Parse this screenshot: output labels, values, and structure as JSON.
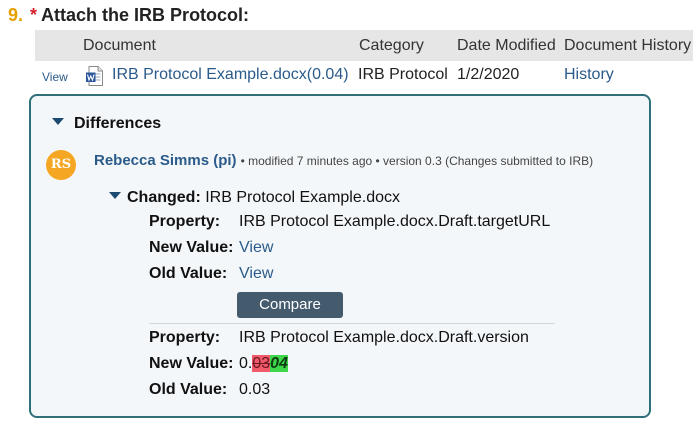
{
  "question": {
    "number": "9.",
    "required_mark": "*",
    "title": "Attach the IRB Protocol:"
  },
  "documents": {
    "columns": {
      "document": "Document",
      "category": "Category",
      "date_modified": "Date Modified",
      "history": "Document History"
    },
    "rows": [
      {
        "view_label": "View",
        "icon": "word-document-icon",
        "name": "IRB Protocol Example.docx(0.04)",
        "category": "IRB Protocol",
        "date_modified": "1/2/2020",
        "history_label": "History"
      }
    ]
  },
  "differences": {
    "title": "Differences",
    "avatar_initials": "RS",
    "avatar_color": "#f5a623",
    "author": "Rebecca Simms (pi)",
    "meta": "• modified 7 minutes ago • version 0.3 (Changes submitted to IRB)",
    "changed_label": "Changed:",
    "changed_item": "IRB Protocol Example.docx",
    "changes": [
      {
        "property_label": "Property:",
        "property": "IRB Protocol Example.docx.Draft.targetURL",
        "new_label": "New Value:",
        "new_value": "View",
        "old_label": "Old Value:",
        "old_value": "View",
        "compare_label": "Compare"
      },
      {
        "property_label": "Property:",
        "property": "IRB Protocol Example.docx.Draft.version",
        "new_label": "New Value:",
        "new_prefix": "0.",
        "new_deleted": "03",
        "new_inserted": "04",
        "old_label": "Old Value:",
        "old_value": "0.03"
      }
    ]
  },
  "colors": {
    "accent_link": "#2b5b8a",
    "box_border": "#2f7078",
    "deleted_highlight": "#f05a6a",
    "inserted_highlight": "#3fd84a",
    "button_bg": "#445b6e"
  }
}
